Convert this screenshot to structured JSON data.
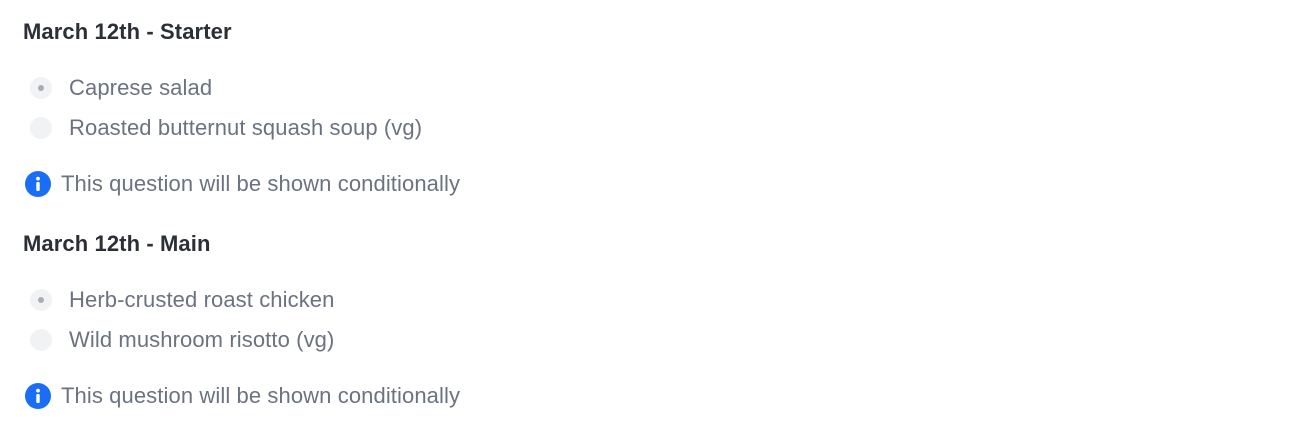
{
  "questions": [
    {
      "title": "March 12th - Starter",
      "options": [
        {
          "label": "Caprese salad",
          "selected": true
        },
        {
          "label": "Roasted butternut squash soup (vg)",
          "selected": false
        }
      ],
      "note": {
        "icon": "info-icon",
        "text": "This question will be shown conditionally"
      }
    },
    {
      "title": "March 12th - Main",
      "options": [
        {
          "label": "Herb-crusted roast chicken",
          "selected": true
        },
        {
          "label": "Wild mushroom risotto (vg)",
          "selected": false
        }
      ],
      "note": {
        "icon": "info-icon",
        "text": "This question will be shown conditionally"
      }
    }
  ],
  "colors": {
    "info_accent": "#1a6ef5",
    "title_text": "#2b2f36",
    "muted_text": "#6b7280"
  }
}
